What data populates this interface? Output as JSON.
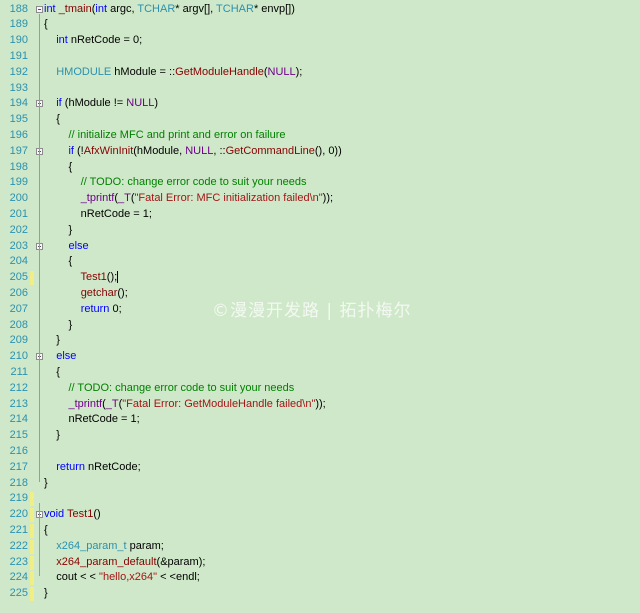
{
  "lines": [
    {
      "n": "188",
      "fold": true,
      "mark": "",
      "tokens": [
        {
          "t": "kw",
          "v": "int"
        },
        {
          "t": "",
          "v": " "
        },
        {
          "t": "fn",
          "v": "_tmain"
        },
        {
          "t": "",
          "v": "("
        },
        {
          "t": "kw",
          "v": "int"
        },
        {
          "t": "",
          "v": " argc, "
        },
        {
          "t": "ty",
          "v": "TCHAR"
        },
        {
          "t": "",
          "v": "* argv[], "
        },
        {
          "t": "ty",
          "v": "TCHAR"
        },
        {
          "t": "",
          "v": "* envp[])"
        }
      ]
    },
    {
      "n": "189",
      "fold": false,
      "mark": "",
      "tokens": [
        {
          "t": "",
          "v": "{"
        }
      ]
    },
    {
      "n": "190",
      "fold": false,
      "mark": "",
      "tokens": [
        {
          "t": "",
          "v": "    "
        },
        {
          "t": "kw",
          "v": "int"
        },
        {
          "t": "",
          "v": " nRetCode = 0;"
        }
      ]
    },
    {
      "n": "191",
      "fold": false,
      "mark": "",
      "tokens": []
    },
    {
      "n": "192",
      "fold": false,
      "mark": "",
      "tokens": [
        {
          "t": "",
          "v": "    "
        },
        {
          "t": "ty",
          "v": "HMODULE"
        },
        {
          "t": "",
          "v": " hModule = ::"
        },
        {
          "t": "fn",
          "v": "GetModuleHandle"
        },
        {
          "t": "",
          "v": "("
        },
        {
          "t": "mc",
          "v": "NULL"
        },
        {
          "t": "",
          "v": ");"
        }
      ]
    },
    {
      "n": "193",
      "fold": false,
      "mark": "",
      "tokens": []
    },
    {
      "n": "194",
      "fold": true,
      "mark": "",
      "tokens": [
        {
          "t": "",
          "v": "    "
        },
        {
          "t": "kw",
          "v": "if"
        },
        {
          "t": "",
          "v": " (hModule != "
        },
        {
          "t": "mc",
          "v": "NULL"
        },
        {
          "t": "",
          "v": ")"
        }
      ]
    },
    {
      "n": "195",
      "fold": false,
      "mark": "",
      "tokens": [
        {
          "t": "",
          "v": "    {"
        }
      ]
    },
    {
      "n": "196",
      "fold": false,
      "mark": "",
      "tokens": [
        {
          "t": "",
          "v": "        "
        },
        {
          "t": "cm",
          "v": "// initialize MFC and print and error on failure"
        }
      ]
    },
    {
      "n": "197",
      "fold": true,
      "mark": "",
      "tokens": [
        {
          "t": "",
          "v": "        "
        },
        {
          "t": "kw",
          "v": "if"
        },
        {
          "t": "",
          "v": " (!"
        },
        {
          "t": "fn",
          "v": "AfxWinInit"
        },
        {
          "t": "",
          "v": "(hModule, "
        },
        {
          "t": "mc",
          "v": "NULL"
        },
        {
          "t": "",
          "v": ", ::"
        },
        {
          "t": "fn",
          "v": "GetCommandLine"
        },
        {
          "t": "",
          "v": "(), 0))"
        }
      ]
    },
    {
      "n": "198",
      "fold": false,
      "mark": "",
      "tokens": [
        {
          "t": "",
          "v": "        {"
        }
      ]
    },
    {
      "n": "199",
      "fold": false,
      "mark": "",
      "tokens": [
        {
          "t": "",
          "v": "            "
        },
        {
          "t": "cm",
          "v": "// TODO: change error code to suit your needs"
        }
      ]
    },
    {
      "n": "200",
      "fold": false,
      "mark": "",
      "tokens": [
        {
          "t": "",
          "v": "            "
        },
        {
          "t": "mc",
          "v": "_tprintf"
        },
        {
          "t": "",
          "v": "("
        },
        {
          "t": "mc",
          "v": "_T"
        },
        {
          "t": "",
          "v": "("
        },
        {
          "t": "st",
          "v": "\"Fatal Error: MFC initialization failed\\n\""
        },
        {
          "t": "",
          "v": "));"
        }
      ]
    },
    {
      "n": "201",
      "fold": false,
      "mark": "",
      "tokens": [
        {
          "t": "",
          "v": "            nRetCode = 1;"
        }
      ]
    },
    {
      "n": "202",
      "fold": false,
      "mark": "",
      "tokens": [
        {
          "t": "",
          "v": "        }"
        }
      ]
    },
    {
      "n": "203",
      "fold": true,
      "mark": "",
      "tokens": [
        {
          "t": "",
          "v": "        "
        },
        {
          "t": "kw",
          "v": "else"
        }
      ]
    },
    {
      "n": "204",
      "fold": false,
      "mark": "",
      "tokens": [
        {
          "t": "",
          "v": "        {"
        }
      ]
    },
    {
      "n": "205",
      "fold": false,
      "mark": "yellow",
      "cursor": true,
      "tokens": [
        {
          "t": "",
          "v": "            "
        },
        {
          "t": "fn",
          "v": "Test1"
        },
        {
          "t": "",
          "v": "();"
        }
      ]
    },
    {
      "n": "206",
      "fold": false,
      "mark": "",
      "tokens": [
        {
          "t": "",
          "v": "            "
        },
        {
          "t": "fn",
          "v": "getchar"
        },
        {
          "t": "",
          "v": "();"
        }
      ]
    },
    {
      "n": "207",
      "fold": false,
      "mark": "",
      "tokens": [
        {
          "t": "",
          "v": "            "
        },
        {
          "t": "kw",
          "v": "return"
        },
        {
          "t": "",
          "v": " 0;"
        }
      ]
    },
    {
      "n": "208",
      "fold": false,
      "mark": "",
      "tokens": [
        {
          "t": "",
          "v": "        }"
        }
      ]
    },
    {
      "n": "209",
      "fold": false,
      "mark": "",
      "tokens": [
        {
          "t": "",
          "v": "    }"
        }
      ]
    },
    {
      "n": "210",
      "fold": true,
      "mark": "",
      "tokens": [
        {
          "t": "",
          "v": "    "
        },
        {
          "t": "kw",
          "v": "else"
        }
      ]
    },
    {
      "n": "211",
      "fold": false,
      "mark": "",
      "tokens": [
        {
          "t": "",
          "v": "    {"
        }
      ]
    },
    {
      "n": "212",
      "fold": false,
      "mark": "",
      "tokens": [
        {
          "t": "",
          "v": "        "
        },
        {
          "t": "cm",
          "v": "// TODO: change error code to suit your needs"
        }
      ]
    },
    {
      "n": "213",
      "fold": false,
      "mark": "",
      "tokens": [
        {
          "t": "",
          "v": "        "
        },
        {
          "t": "mc",
          "v": "_tprintf"
        },
        {
          "t": "",
          "v": "("
        },
        {
          "t": "mc",
          "v": "_T"
        },
        {
          "t": "",
          "v": "("
        },
        {
          "t": "st",
          "v": "\"Fatal Error: GetModuleHandle failed\\n\""
        },
        {
          "t": "",
          "v": "));"
        }
      ]
    },
    {
      "n": "214",
      "fold": false,
      "mark": "",
      "tokens": [
        {
          "t": "",
          "v": "        nRetCode = 1;"
        }
      ]
    },
    {
      "n": "215",
      "fold": false,
      "mark": "",
      "tokens": [
        {
          "t": "",
          "v": "    }"
        }
      ]
    },
    {
      "n": "216",
      "fold": false,
      "mark": "",
      "tokens": []
    },
    {
      "n": "217",
      "fold": false,
      "mark": "",
      "tokens": [
        {
          "t": "",
          "v": "    "
        },
        {
          "t": "kw",
          "v": "return"
        },
        {
          "t": "",
          "v": " nRetCode;"
        }
      ]
    },
    {
      "n": "218",
      "fold": false,
      "mark": "",
      "tokens": [
        {
          "t": "",
          "v": "}"
        }
      ]
    },
    {
      "n": "219",
      "fold": false,
      "mark": "yellow",
      "tokens": []
    },
    {
      "n": "220",
      "fold": true,
      "mark": "yellow",
      "tokens": [
        {
          "t": "kw",
          "v": "void"
        },
        {
          "t": "",
          "v": " "
        },
        {
          "t": "fn",
          "v": "Test1"
        },
        {
          "t": "",
          "v": "()"
        }
      ]
    },
    {
      "n": "221",
      "fold": false,
      "mark": "yellow",
      "tokens": [
        {
          "t": "",
          "v": "{"
        }
      ]
    },
    {
      "n": "222",
      "fold": false,
      "mark": "yellow",
      "tokens": [
        {
          "t": "",
          "v": "    "
        },
        {
          "t": "ty",
          "v": "x264_param_t"
        },
        {
          "t": "",
          "v": " param;"
        }
      ]
    },
    {
      "n": "223",
      "fold": false,
      "mark": "yellow",
      "tokens": [
        {
          "t": "",
          "v": "    "
        },
        {
          "t": "fn",
          "v": "x264_param_default"
        },
        {
          "t": "",
          "v": "(&param);"
        }
      ]
    },
    {
      "n": "224",
      "fold": false,
      "mark": "yellow",
      "tokens": [
        {
          "t": "",
          "v": "    cout < < "
        },
        {
          "t": "st",
          "v": "\"hello,x264\""
        },
        {
          "t": "",
          "v": " < <endl;"
        }
      ]
    },
    {
      "n": "225",
      "fold": false,
      "mark": "yellow",
      "tokens": [
        {
          "t": "",
          "v": "}"
        }
      ]
    }
  ],
  "watermark": "©漫漫开发路 | 拓扑梅尔",
  "colors": {
    "background": "#cfe8c9",
    "line_number": "#2b91af",
    "keyword": "#0000ff",
    "function": "#880000",
    "macro": "#6f008a",
    "comment": "#008000",
    "string": "#a31515",
    "change_mark": "#f0ef85"
  },
  "icons": {
    "fold": "minus-box-icon"
  }
}
